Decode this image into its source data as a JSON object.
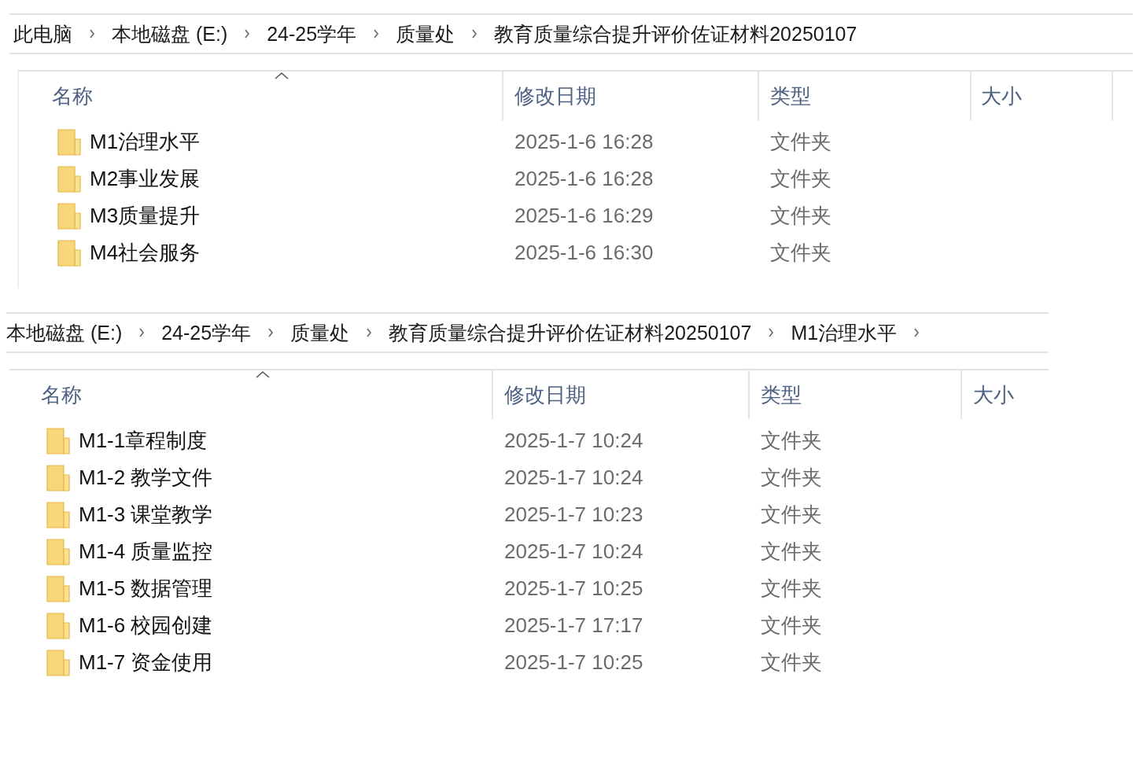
{
  "windows": [
    {
      "breadcrumb": [
        "此电脑",
        "本地磁盘 (E:)",
        "24-25学年",
        "质量处",
        "教育质量综合提升评价佐证材料20250107"
      ],
      "trailing_separator": false,
      "columns": [
        {
          "label": "名称",
          "sorted": true
        },
        {
          "label": "修改日期",
          "sorted": false
        },
        {
          "label": "类型",
          "sorted": false
        },
        {
          "label": "大小",
          "sorted": false
        }
      ],
      "rows": [
        {
          "name": "M1治理水平",
          "modified": "2025-1-6 16:28",
          "type": "文件夹"
        },
        {
          "name": "M2事业发展",
          "modified": "2025-1-6 16:28",
          "type": "文件夹"
        },
        {
          "name": "M3质量提升",
          "modified": "2025-1-6 16:29",
          "type": "文件夹"
        },
        {
          "name": "M4社会服务",
          "modified": "2025-1-6 16:30",
          "type": "文件夹"
        }
      ]
    },
    {
      "breadcrumb": [
        "本地磁盘 (E:)",
        "24-25学年",
        "质量处",
        "教育质量综合提升评价佐证材料20250107",
        "M1治理水平"
      ],
      "trailing_separator": true,
      "columns": [
        {
          "label": "名称",
          "sorted": true
        },
        {
          "label": "修改日期",
          "sorted": false
        },
        {
          "label": "类型",
          "sorted": false
        },
        {
          "label": "大小",
          "sorted": false
        }
      ],
      "rows": [
        {
          "name": "M1-1章程制度",
          "modified": "2025-1-7 10:24",
          "type": "文件夹"
        },
        {
          "name": "M1-2 教学文件",
          "modified": "2025-1-7 10:24",
          "type": "文件夹"
        },
        {
          "name": "M1-3 课堂教学",
          "modified": "2025-1-7 10:23",
          "type": "文件夹"
        },
        {
          "name": "M1-4 质量监控",
          "modified": "2025-1-7 10:24",
          "type": "文件夹"
        },
        {
          "name": "M1-5 数据管理",
          "modified": "2025-1-7 10:25",
          "type": "文件夹"
        },
        {
          "name": "M1-6 校园创建",
          "modified": "2025-1-7 17:17",
          "type": "文件夹"
        },
        {
          "name": "M1-7 资金使用",
          "modified": "2025-1-7 10:25",
          "type": "文件夹"
        }
      ]
    }
  ]
}
